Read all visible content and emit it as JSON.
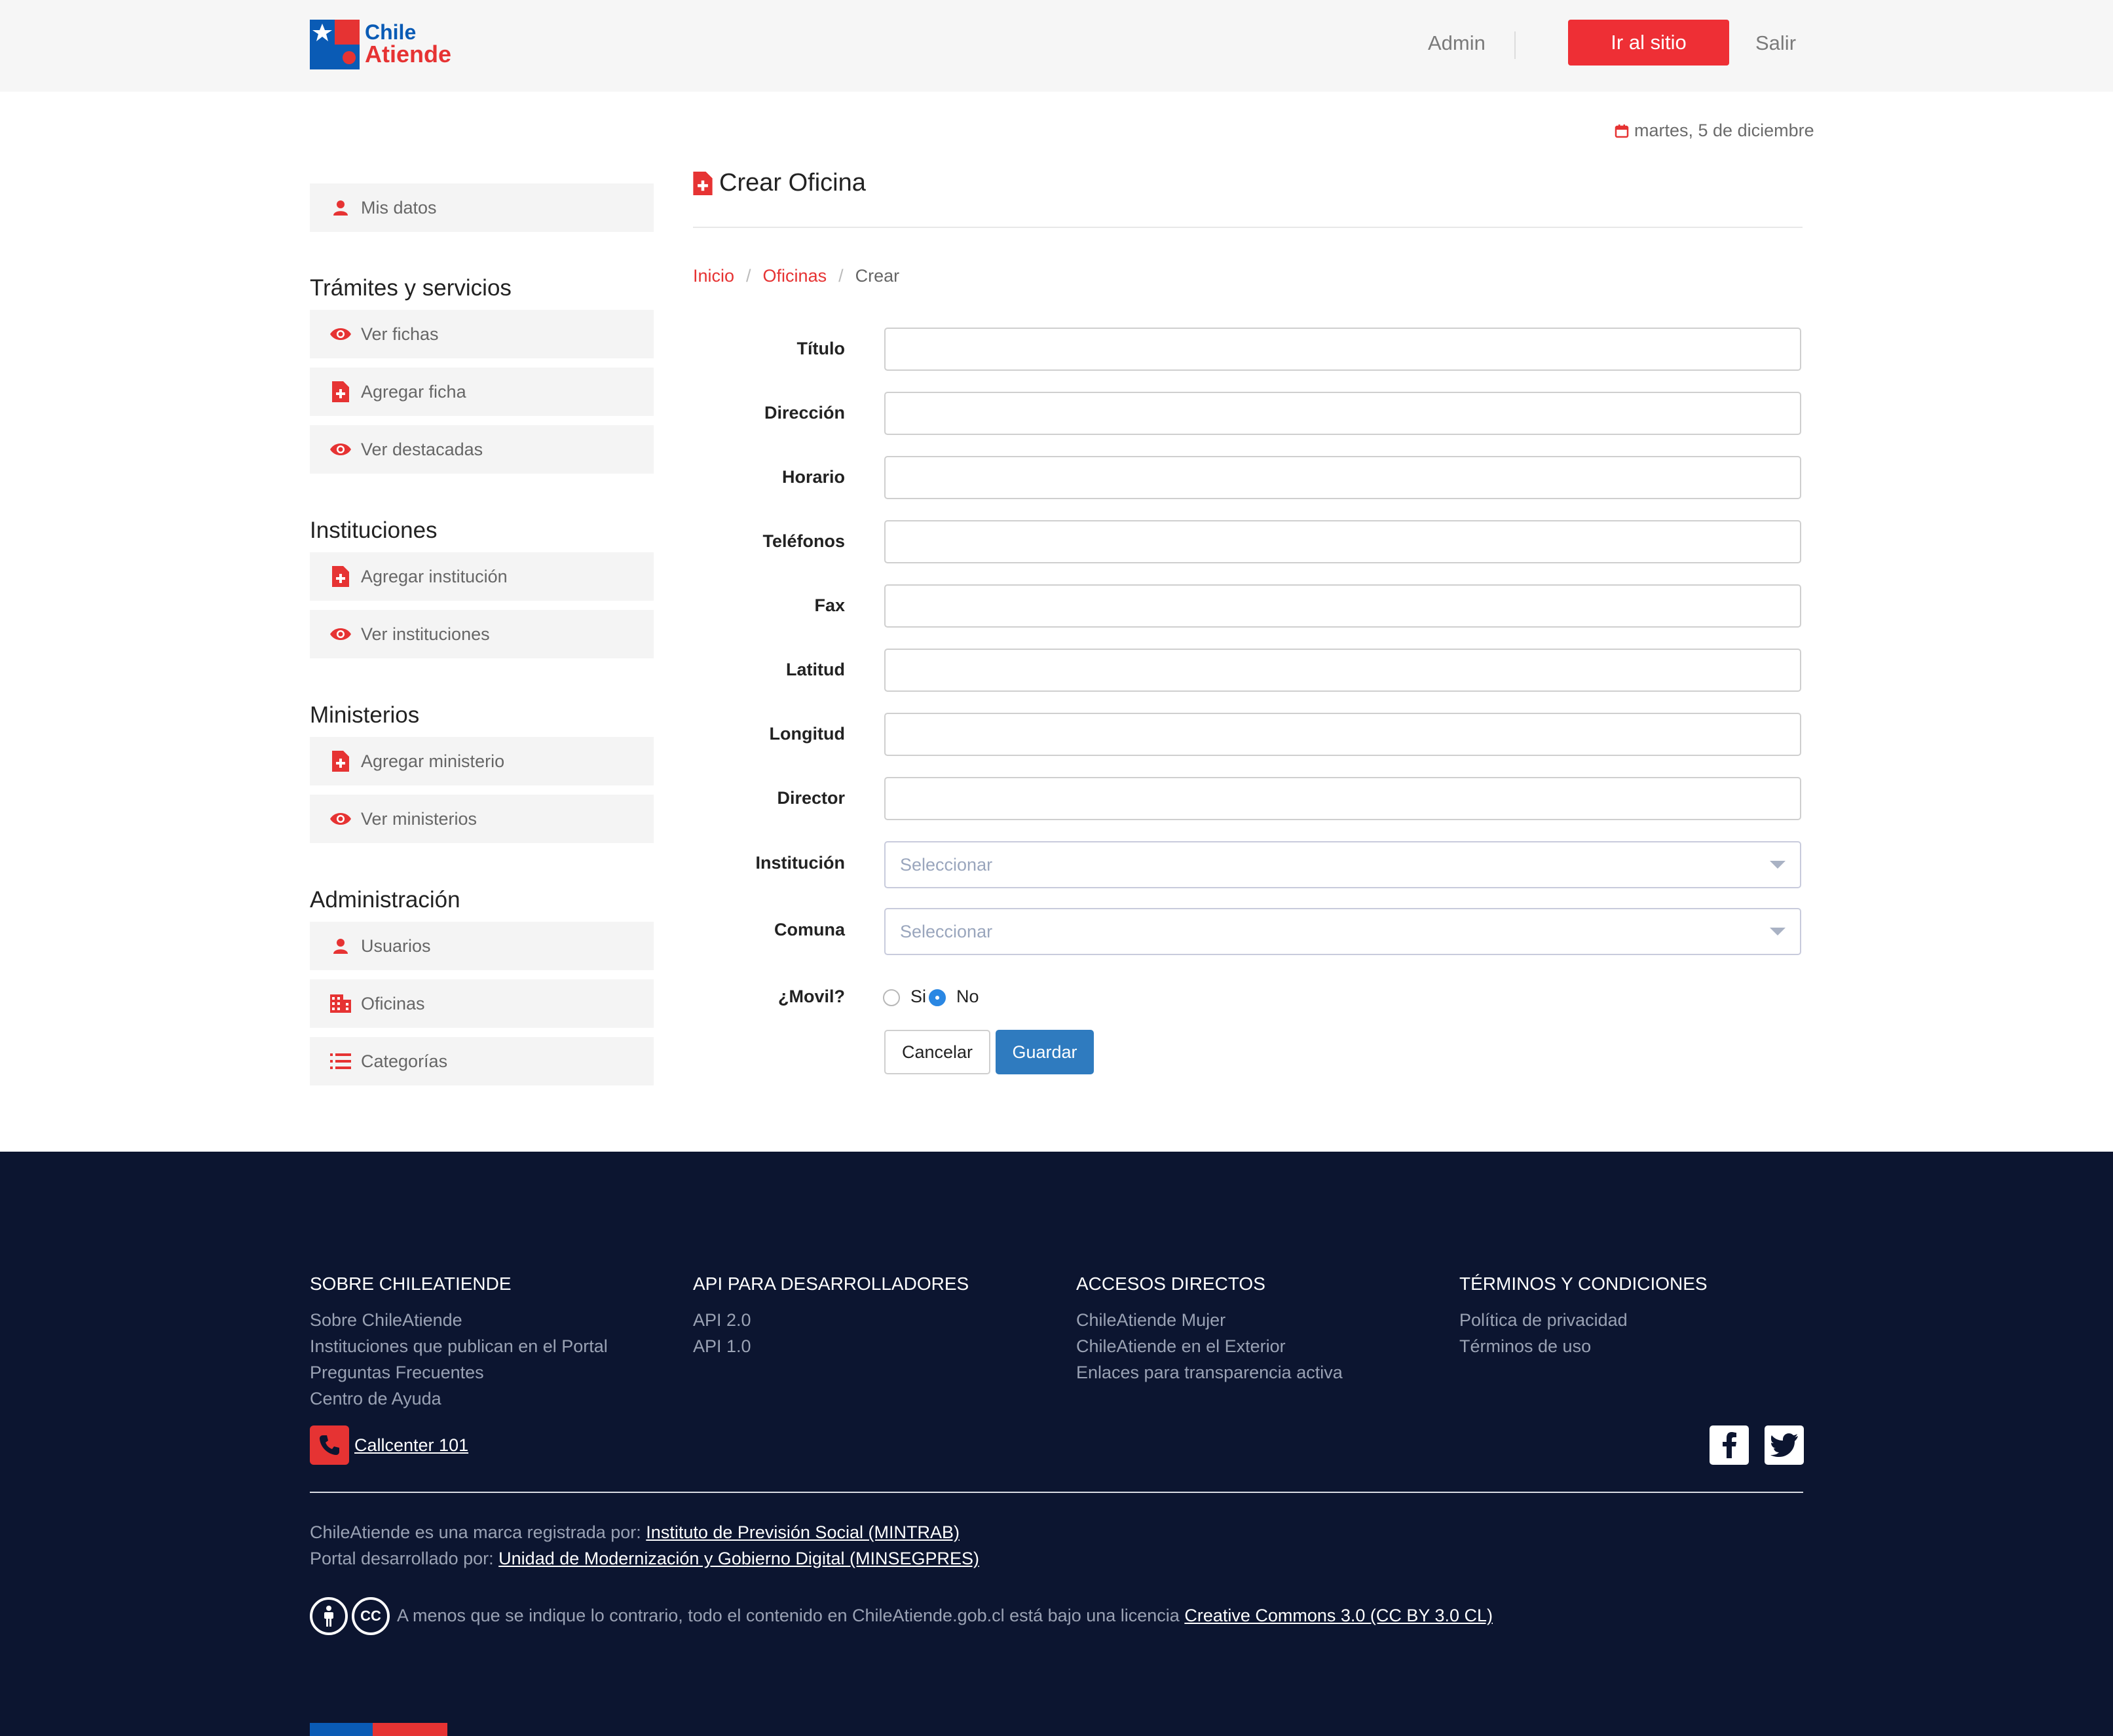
{
  "header": {
    "logo_line1": "Chile",
    "logo_line2": "Atiende",
    "admin_label": "Admin",
    "site_button": "Ir al sitio",
    "logout_label": "Salir"
  },
  "date": "martes, 5 de diciembre",
  "sidebar": {
    "my_data": "Mis datos",
    "sections": [
      {
        "title": "Trámites y servicios",
        "items": [
          "Ver fichas",
          "Agregar ficha",
          "Ver destacadas"
        ]
      },
      {
        "title": "Instituciones",
        "items": [
          "Agregar institución",
          "Ver instituciones"
        ]
      },
      {
        "title": "Ministerios",
        "items": [
          "Agregar ministerio",
          "Ver ministerios"
        ]
      },
      {
        "title": "Administración",
        "items": [
          "Usuarios",
          "Oficinas",
          "Categorías"
        ]
      }
    ]
  },
  "main": {
    "title": "Crear Oficina",
    "breadcrumb": [
      "Inicio",
      "Oficinas",
      "Crear"
    ],
    "fields": [
      "Título",
      "Dirección",
      "Horario",
      "Teléfonos",
      "Fax",
      "Latitud",
      "Longitud",
      "Director"
    ],
    "selects": [
      {
        "label": "Institución",
        "value": "Seleccionar"
      },
      {
        "label": "Comuna",
        "value": "Seleccionar"
      }
    ],
    "mobile": {
      "label": "¿Movil?",
      "options": [
        "Si",
        "No"
      ],
      "selected": "No"
    },
    "cancel_button": "Cancelar",
    "save_button": "Guardar"
  },
  "footer": {
    "columns": [
      {
        "title": "SOBRE CHILEATIENDE",
        "links": [
          "Sobre ChileAtiende",
          "Instituciones que publican en el Portal",
          "Preguntas Frecuentes",
          "Centro de Ayuda"
        ]
      },
      {
        "title": "API PARA DESARROLLADORES",
        "links": [
          "API 2.0",
          "API 1.0"
        ]
      },
      {
        "title": "ACCESOS DIRECTOS",
        "links": [
          "ChileAtiende Mujer",
          "ChileAtiende en el Exterior",
          "Enlaces para transparencia activa"
        ]
      },
      {
        "title": "TÉRMINOS Y CONDICIONES",
        "links": [
          "Política de privacidad",
          "Términos de uso"
        ]
      }
    ],
    "callcenter": "Callcenter 101",
    "brand_text": "ChileAtiende es una marca registrada por:",
    "brand_link": "Instituto de Previsión Social (MINTRAB)",
    "dev_text": "Portal desarrollado por:",
    "dev_link": "Unidad de Modernización y Gobierno Digital (MINSEGPRES)",
    "license_text": "A menos que se indique lo contrario, todo el contenido en ChileAtiende.gob.cl está bajo una licencia",
    "license_link": "Creative Commons 3.0 (CC BY 3.0 CL)",
    "cc_label": "CC"
  },
  "colors": {
    "accent_red": "#ee2f35",
    "brand_blue": "#0a5bb5",
    "primary_button": "#2f7bbf",
    "footer_bg": "#0c1530"
  },
  "icons": [
    "calendar-icon",
    "user-icon",
    "eye-icon",
    "file-add-icon",
    "building-icon",
    "list-icon",
    "phone-icon",
    "facebook-icon",
    "twitter-icon",
    "attribution-icon",
    "cc-icon"
  ]
}
